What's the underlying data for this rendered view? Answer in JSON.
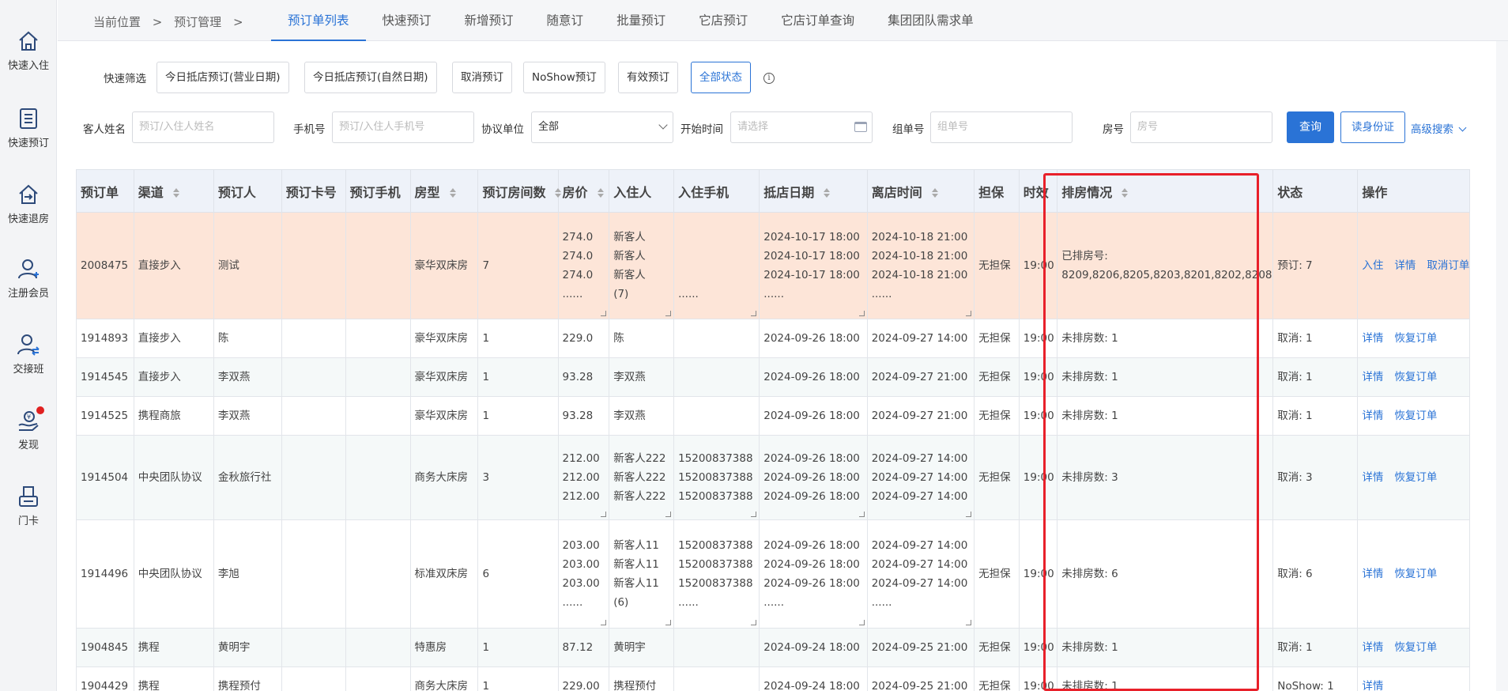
{
  "sidebar": {
    "items": [
      {
        "label": "快速入住",
        "icon": "home-icon"
      },
      {
        "label": "快速预订",
        "icon": "list-icon"
      },
      {
        "label": "快速退房",
        "icon": "checkout-home-icon"
      },
      {
        "label": "注册会员",
        "icon": "user-add-icon"
      },
      {
        "label": "交接班",
        "icon": "shift-handover-icon"
      },
      {
        "label": "发现",
        "icon": "discover-hand-icon"
      },
      {
        "label": "门卡",
        "icon": "card-printer-icon"
      }
    ]
  },
  "breadcrumb": {
    "location": "当前位置",
    "sep": ">",
    "section": "预订管理",
    "sep2": ">"
  },
  "tabs": [
    "预订单列表",
    "快速预订",
    "新增预订",
    "随意订",
    "批量预订",
    "它店预订",
    "它店订单查询",
    "集团团队需求单"
  ],
  "quick_filter": {
    "label": "快速筛选",
    "buttons": [
      "今日抵店预订(营业日期)",
      "今日抵店预订(自然日期)",
      "取消预订",
      "NoShow预订",
      "有效预订",
      "全部状态"
    ]
  },
  "search": {
    "guest_name_label": "客人姓名",
    "guest_name_placeholder": "预订/入住人姓名",
    "phone_label": "手机号",
    "phone_placeholder": "预订/入住人手机号",
    "agreement_label": "协议单位",
    "agreement_value": "全部",
    "start_time_label": "开始时间",
    "start_time_placeholder": "请选择",
    "group_no_label": "组单号",
    "group_no_placeholder": "组单号",
    "room_no_label": "房号",
    "room_no_placeholder": "房号",
    "query_button": "查询",
    "read_id_button": "读身份证",
    "advanced_search": "高级搜索"
  },
  "table": {
    "headers": [
      "预订单",
      "渠道",
      "预订人",
      "预订卡号",
      "预订手机",
      "房型",
      "预订房间数",
      "房价",
      "入住人",
      "入住手机",
      "抵店日期",
      "离店时间",
      "担保",
      "时效",
      "排房情况",
      "状态",
      "操作"
    ],
    "rows": [
      {
        "id": "2008475",
        "channel": "直接步入",
        "booker": "测试",
        "card": "",
        "mobile": "",
        "room_type": "豪华双床房",
        "rooms": "7",
        "price": [
          "274.0",
          "274.0",
          "274.0",
          "......"
        ],
        "guest": [
          "新客人",
          "新客人",
          "新客人",
          "(7)"
        ],
        "guest_phone": [
          "",
          "",
          "",
          "......"
        ],
        "arrival": [
          "2024-10-17 18:00",
          "2024-10-17 18:00",
          "2024-10-17 18:00",
          "......"
        ],
        "departure": [
          "2024-10-18 21:00",
          "2024-10-18 21:00",
          "2024-10-18 21:00",
          "......"
        ],
        "guarantee": "无担保",
        "hold": "19:00",
        "assign": [
          "已排房号:",
          "8209,8206,8205,8203,8201,8202,8208"
        ],
        "status": "预订: 7",
        "actions": [
          "入住",
          "详情",
          "取消订单"
        ]
      },
      {
        "id": "1914893",
        "channel": "直接步入",
        "booker": "陈",
        "card": "",
        "mobile": "",
        "room_type": "豪华双床房",
        "rooms": "1",
        "price": [
          "229.0"
        ],
        "guest": [
          "陈"
        ],
        "guest_phone": [
          ""
        ],
        "arrival": [
          "2024-09-26 18:00"
        ],
        "departure": [
          "2024-09-27 14:00"
        ],
        "guarantee": "无担保",
        "hold": "19:00",
        "assign": [
          "未排房数: 1"
        ],
        "status": "取消: 1",
        "actions": [
          "详情",
          "恢复订单"
        ]
      },
      {
        "id": "1914545",
        "channel": "直接步入",
        "booker": "李双燕",
        "card": "",
        "mobile": "",
        "room_type": "豪华双床房",
        "rooms": "1",
        "price": [
          "93.28"
        ],
        "guest": [
          "李双燕"
        ],
        "guest_phone": [
          ""
        ],
        "arrival": [
          "2024-09-26 18:00"
        ],
        "departure": [
          "2024-09-27 21:00"
        ],
        "guarantee": "无担保",
        "hold": "19:00",
        "assign": [
          "未排房数: 1"
        ],
        "status": "取消: 1",
        "actions": [
          "详情",
          "恢复订单"
        ]
      },
      {
        "id": "1914525",
        "channel": "携程商旅",
        "booker": "李双燕",
        "card": "",
        "mobile": "",
        "room_type": "豪华双床房",
        "rooms": "1",
        "price": [
          "93.28"
        ],
        "guest": [
          "李双燕"
        ],
        "guest_phone": [
          ""
        ],
        "arrival": [
          "2024-09-26 18:00"
        ],
        "departure": [
          "2024-09-27 21:00"
        ],
        "guarantee": "无担保",
        "hold": "19:00",
        "assign": [
          "未排房数: 1"
        ],
        "status": "取消: 1",
        "actions": [
          "详情",
          "恢复订单"
        ]
      },
      {
        "id": "1914504",
        "channel": "中央团队协议",
        "booker": "金秋旅行社",
        "card": "",
        "mobile": "",
        "room_type": "商务大床房",
        "rooms": "3",
        "price": [
          "212.00",
          "212.00",
          "212.00"
        ],
        "guest": [
          "新客人222",
          "新客人222",
          "新客人222"
        ],
        "guest_phone": [
          "15200837388",
          "15200837388",
          "15200837388"
        ],
        "arrival": [
          "2024-09-26 18:00",
          "2024-09-26 18:00",
          "2024-09-26 18:00"
        ],
        "departure": [
          "2024-09-27 14:00",
          "2024-09-27 14:00",
          "2024-09-27 14:00"
        ],
        "guarantee": "无担保",
        "hold": "19:00",
        "assign": [
          "未排房数: 3"
        ],
        "status": "取消: 3",
        "actions": [
          "详情",
          "恢复订单"
        ]
      },
      {
        "id": "1914496",
        "channel": "中央团队协议",
        "booker": "李旭",
        "card": "",
        "mobile": "",
        "room_type": "标准双床房",
        "rooms": "6",
        "price": [
          "203.00",
          "203.00",
          "203.00",
          "......"
        ],
        "guest": [
          "新客人11",
          "新客人11",
          "新客人11",
          "(6)"
        ],
        "guest_phone": [
          "15200837388",
          "15200837388",
          "15200837388",
          "......"
        ],
        "arrival": [
          "2024-09-26 18:00",
          "2024-09-26 18:00",
          "2024-09-26 18:00",
          "......"
        ],
        "departure": [
          "2024-09-27 14:00",
          "2024-09-27 14:00",
          "2024-09-27 14:00",
          "......"
        ],
        "guarantee": "无担保",
        "hold": "19:00",
        "assign": [
          "未排房数: 6"
        ],
        "status": "取消: 6",
        "actions": [
          "详情",
          "恢复订单"
        ]
      },
      {
        "id": "1904845",
        "channel": "携程",
        "booker": "黄明宇",
        "card": "",
        "mobile": "",
        "room_type": "特惠房",
        "rooms": "1",
        "price": [
          "87.12"
        ],
        "guest": [
          "黄明宇"
        ],
        "guest_phone": [
          ""
        ],
        "arrival": [
          "2024-09-24 18:00"
        ],
        "departure": [
          "2024-09-25 21:00"
        ],
        "guarantee": "无担保",
        "hold": "19:00",
        "assign": [
          "未排房数: 1"
        ],
        "status": "取消: 1",
        "actions": [
          "详情",
          "恢复订单"
        ]
      },
      {
        "id": "1904429",
        "channel": "携程",
        "booker": "携程预付",
        "card": "",
        "mobile": "",
        "room_type": "商务大床房",
        "rooms": "1",
        "price": [
          "229.00"
        ],
        "guest": [
          "携程预付"
        ],
        "guest_phone": [
          ""
        ],
        "arrival": [
          "2024-09-24 18:00"
        ],
        "departure": [
          "2024-09-25 21:00"
        ],
        "guarantee": "无担保",
        "hold": "19:00",
        "assign": [
          "未排房数: 1"
        ],
        "status": "NoShow: 1",
        "actions": [
          "详情"
        ]
      }
    ]
  },
  "colors": {
    "accent": "#2a73d6",
    "highlight_row": "#fde5d8",
    "annotation_box": "#e8202a",
    "badge": "#e02020"
  }
}
